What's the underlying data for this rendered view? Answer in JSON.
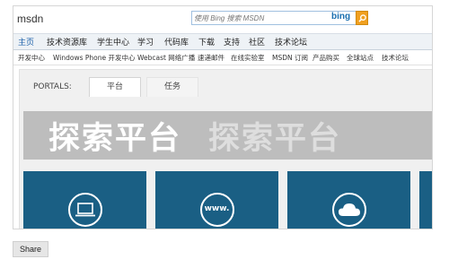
{
  "header": {
    "logo": "msdn",
    "search_placeholder": "使用 Bing 搜索 MSDN",
    "search_brand": "bing"
  },
  "nav": {
    "items": [
      {
        "label": "主页"
      },
      {
        "label": "技术资源库"
      },
      {
        "label": "学生中心"
      },
      {
        "label": "学习"
      },
      {
        "label": "代码库"
      },
      {
        "label": "下载"
      },
      {
        "label": "支持"
      },
      {
        "label": "社区"
      },
      {
        "label": "技术论坛"
      }
    ]
  },
  "subnav": {
    "items": [
      {
        "label": "开发中心"
      },
      {
        "label": "Windows Phone 开发中心"
      },
      {
        "label": "Webcast 网络广播"
      },
      {
        "label": "速递邮件"
      },
      {
        "label": "在线实验室"
      },
      {
        "label": "MSDN 订阅"
      },
      {
        "label": "产品购买"
      },
      {
        "label": "全球站点"
      },
      {
        "label": "技术论坛"
      }
    ]
  },
  "portals": {
    "label": "PORTALS:",
    "tabs": [
      {
        "label": "平台",
        "active": true
      },
      {
        "label": "任务",
        "active": false
      }
    ]
  },
  "hero": {
    "title_primary": "探索平台",
    "title_secondary": "探索平台"
  },
  "tiles": [
    {
      "icon": "laptop-icon"
    },
    {
      "icon": "www-icon",
      "text": "www."
    },
    {
      "icon": "cloud-icon"
    }
  ],
  "share": {
    "label": "Share"
  },
  "colors": {
    "tile_blue": "#1a5f84",
    "hero_gray": "#bdbdbd",
    "nav_bg": "#eef2f6",
    "bing_orange": "#f0a020"
  }
}
